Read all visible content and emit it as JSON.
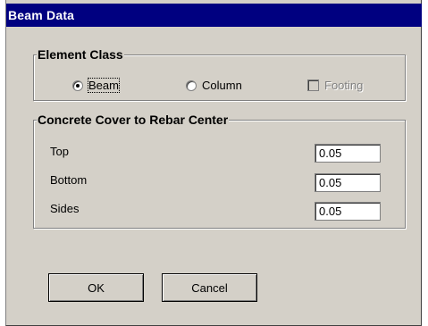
{
  "window": {
    "title": "Beam Data"
  },
  "element_class": {
    "legend": "Element Class",
    "options": [
      {
        "label": "Beam",
        "selected": true
      },
      {
        "label": "Column",
        "selected": false
      }
    ],
    "footing": {
      "label": "Footing",
      "checked": false,
      "enabled": false
    }
  },
  "concrete_cover": {
    "legend": "Concrete Cover to Rebar Center",
    "fields": [
      {
        "label": "Top",
        "value": "0.05"
      },
      {
        "label": "Bottom",
        "value": "0.05"
      },
      {
        "label": "Sides",
        "value": "0.05"
      }
    ]
  },
  "buttons": {
    "ok": "OK",
    "cancel": "Cancel"
  }
}
